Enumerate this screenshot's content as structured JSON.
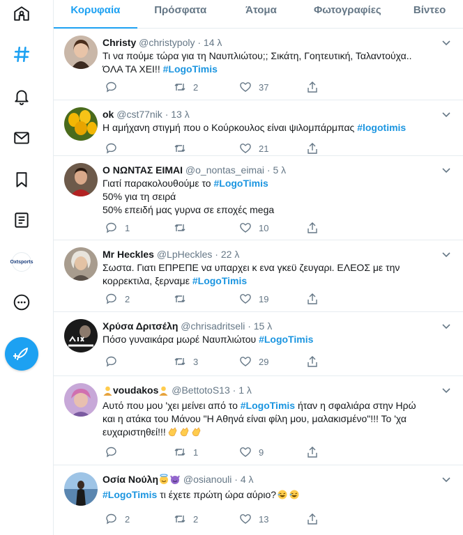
{
  "tabs": [
    "Κορυφαία",
    "Πρόσφατα",
    "Άτομα",
    "Φωτογραφίες",
    "Βίντεο"
  ],
  "sidebar": {
    "profile_label": "Oxtsports"
  },
  "tweets": [
    {
      "name": "Christy",
      "handle": "@christypoly",
      "dot": "·",
      "time": "14 λ",
      "lines": [
        "Τι να πούμε τώρα για τη Ναυπλιώτου;; Σικάτη, Γοητευτική, Ταλαντούχα..",
        "ΌΛΑ ΤΑ ΧΕΙ!!"
      ],
      "hashtag": "#LogoTimis",
      "reply": "",
      "retweet": "2",
      "like": "37"
    },
    {
      "name": "ok",
      "handle": "@cst77nik",
      "dot": "·",
      "time": "13 λ",
      "lines": [
        "Η αμήχανη στιγμή που ο Κούρκουλος είναι ψιλομπάρμπας"
      ],
      "hashtag": "#logotimis",
      "reply": "",
      "retweet": "",
      "like": "21"
    },
    {
      "name": "Ο ΝΩΝΤΑΣ ΕΙΜΑΙ",
      "handle": "@o_nontas_eimai",
      "dot": "·",
      "time": "5 λ",
      "lines": [
        "Γιατί παρακολουθούμε το",
        "50% για τη σειρά",
        "50% επειδή μας γυρνα σε εποχές mega"
      ],
      "hashtag": "#LogoTimis",
      "reply": "1",
      "retweet": "",
      "like": "10"
    },
    {
      "name": "Mr Heckles",
      "handle": "@LpHeckles",
      "dot": "·",
      "time": "22 λ",
      "lines": [
        "Σωστα. Γιατι ΕΠΡΕΠΕ να υπαρχει κ ενα γκεϋ ζευγαρι. ΕΛΕΟΣ με την",
        "κορρεκτιλα, ξερναμε"
      ],
      "hashtag": "#LogoTimis",
      "reply": "2",
      "retweet": "",
      "like": "19"
    },
    {
      "name": "Χρύσα Δριτσέλη",
      "handle": "@chrisadritseli",
      "dot": "·",
      "time": "15 λ",
      "lines": [
        "Πόσο γυναικάρα μωρέ Ναυπλιώτου"
      ],
      "hashtag": "#LogoTimis",
      "reply": "",
      "retweet": "3",
      "like": "29"
    },
    {
      "name": "voudakos",
      "handle": "@BettotoS13",
      "dot": "·",
      "time": "1 λ",
      "lines": [
        "Αυτό που μου 'χει μείνει από το",
        "ήταν η σφαλιάρα στην Ηρώ",
        "και η ατάκα του Μάνου \"Η Αθηνά είναι φίλη μου, μαλακισμένο\"!!! Το 'χα",
        "ευχαριστηθεί!!!"
      ],
      "hashtag": "#LogoTimis",
      "reply": "",
      "retweet": "1",
      "like": "9"
    },
    {
      "name": "Οσία Νούλη",
      "handle": "@osianouli",
      "dot": "·",
      "time": "4 λ",
      "lines": [
        "τι έχετε πρώτη ώρα αύριο?"
      ],
      "hashtag": "#LogoTimis",
      "reply": "2",
      "retweet": "2",
      "like": "13"
    }
  ],
  "colors": {
    "accent": "#1da1f2",
    "link": "#1b95e0",
    "muted": "#657786",
    "border": "#e6ecf0"
  },
  "icons": [
    "home-icon",
    "hashtag-icon",
    "bell-icon",
    "mail-icon",
    "bookmark-icon",
    "list-icon",
    "more-icon",
    "compose-icon",
    "reply-icon",
    "retweet-icon",
    "heart-icon",
    "share-icon",
    "chevron-down-icon"
  ]
}
